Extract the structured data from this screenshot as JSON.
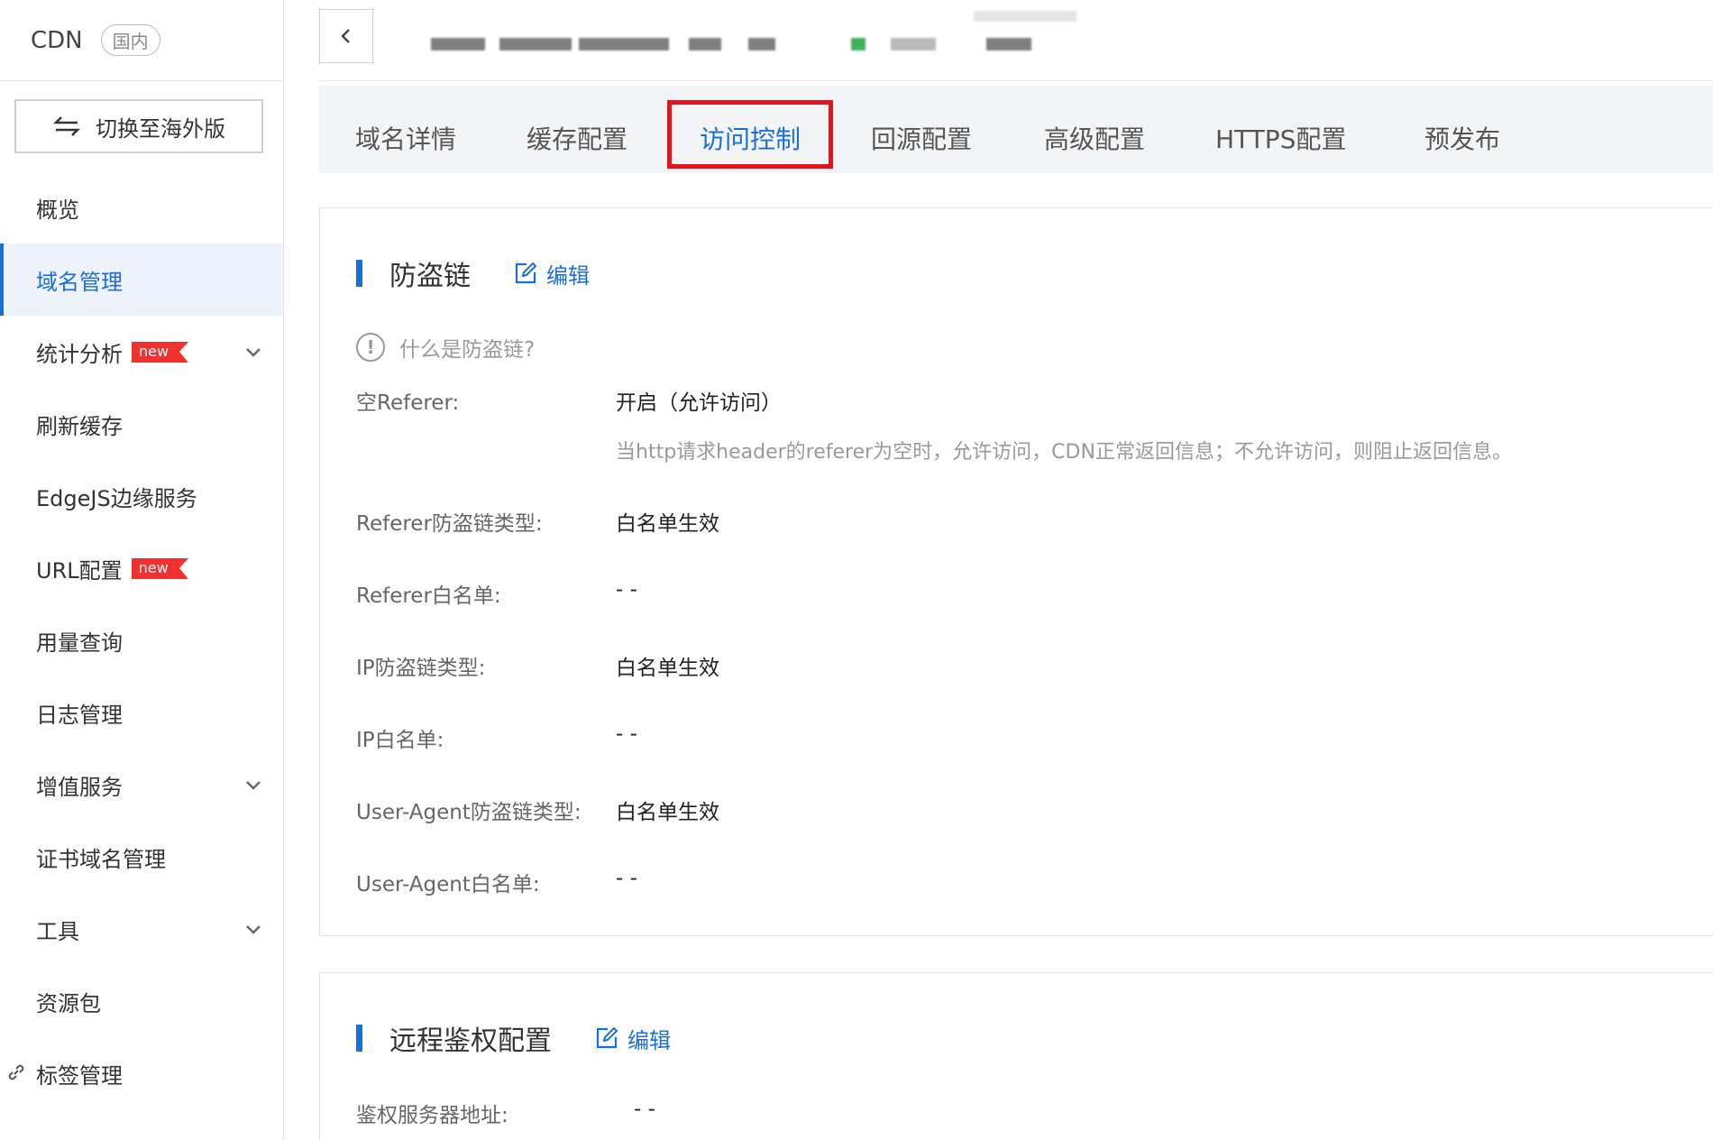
{
  "sidebar": {
    "brand": "CDN",
    "region": "国内",
    "switch_label": "切换至海外版",
    "items": [
      {
        "label": "概览"
      },
      {
        "label": "域名管理"
      },
      {
        "label": "统计分析",
        "badge": "new"
      },
      {
        "label": "刷新缓存"
      },
      {
        "label": "EdgeJS边缘服务"
      },
      {
        "label": "URL配置",
        "badge": "new"
      },
      {
        "label": "用量查询"
      },
      {
        "label": "日志管理"
      },
      {
        "label": "增值服务"
      },
      {
        "label": "证书域名管理"
      },
      {
        "label": "工具"
      },
      {
        "label": "资源包"
      },
      {
        "label": "标签管理"
      }
    ]
  },
  "tabs": [
    {
      "label": "域名详情"
    },
    {
      "label": "缓存配置"
    },
    {
      "label": "访问控制"
    },
    {
      "label": "回源配置"
    },
    {
      "label": "高级配置"
    },
    {
      "label": "HTTPS配置"
    },
    {
      "label": "预发布"
    }
  ],
  "anti_leech": {
    "title": "防盗链",
    "edit": "编辑",
    "help": "什么是防盗链?",
    "rows": [
      {
        "label": "空Referer:",
        "value": "开启（允许访问）",
        "desc": "当http请求header的referer为空时，允许访问，CDN正常返回信息；不允许访问，则阻止返回信息。"
      },
      {
        "label": "Referer防盗链类型:",
        "value": "白名单生效"
      },
      {
        "label": "Referer白名单:",
        "value": "- -"
      },
      {
        "label": "IP防盗链类型:",
        "value": "白名单生效"
      },
      {
        "label": "IP白名单:",
        "value": "- -"
      },
      {
        "label": "User-Agent防盗链类型:",
        "value": "白名单生效"
      },
      {
        "label": "User-Agent白名单:",
        "value": "- -"
      }
    ]
  },
  "remote_auth": {
    "title": "远程鉴权配置",
    "edit": "编辑",
    "rows": [
      {
        "label": "鉴权服务器地址:",
        "value": "- -"
      }
    ]
  },
  "colors": {
    "accent": "#1a6fd6",
    "badge": "#f0322f",
    "highlight": "#e3141d"
  }
}
